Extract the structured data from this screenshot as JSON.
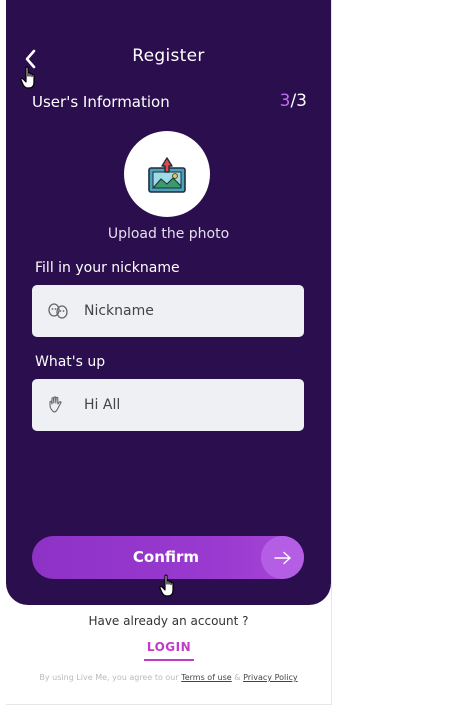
{
  "header": {
    "title": "Register"
  },
  "section": {
    "title": "User's Information",
    "step_current": "3",
    "step_total": "/3"
  },
  "photo": {
    "label": "Upload the photo"
  },
  "nickname": {
    "label": "Fill in your nickname",
    "placeholder": "Nickname",
    "icon": "mask-icon"
  },
  "status": {
    "label": "What's up",
    "placeholder": "Hi All",
    "icon": "waving-hand-icon"
  },
  "actions": {
    "confirm_label": "Confirm"
  },
  "footer": {
    "have_account": "Have already an account ?",
    "login": "LOGIN",
    "legal_prefix": "By using Live Me, you agree to our",
    "terms": "Terms of use",
    "amp": "&",
    "privacy": "Privacy Policy"
  },
  "colors": {
    "panel": "#2a0e4d",
    "accent": "#9a3ad0",
    "step_highlight": "#c06cf0",
    "login": "#c03bc9"
  }
}
